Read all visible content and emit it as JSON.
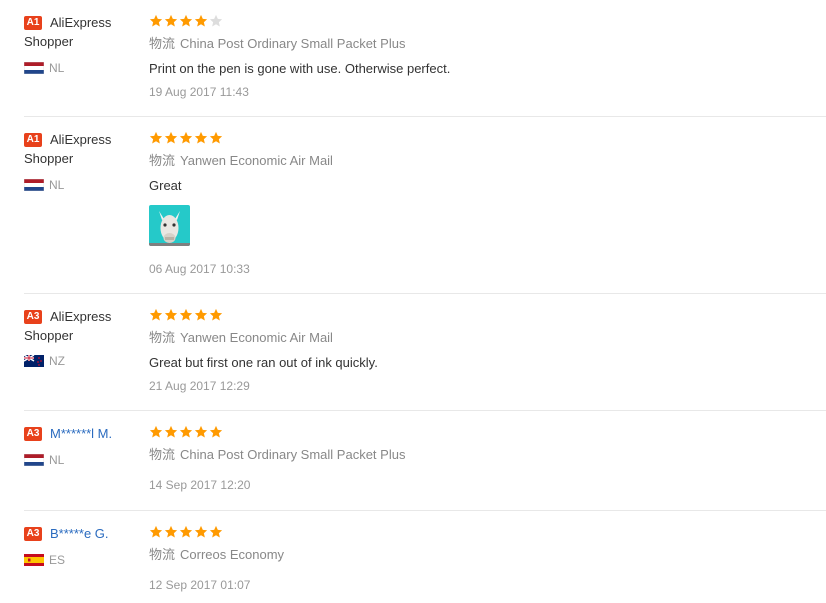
{
  "colors": {
    "badge_red": "#e8411b",
    "star_orange": "#ff9a00",
    "star_gray": "#dddddd",
    "link_blue": "#2a6bbf"
  },
  "reviews": [
    {
      "badge": "A1",
      "name_line1": "AliExpress",
      "name_line2": "Shopper",
      "country": "NL",
      "flag": "netherlands-flag-icon",
      "rating": 4,
      "logistics_label": "物流",
      "logistics": "China Post Ordinary Small Packet Plus",
      "comment": "Print on the pen is gone with use. Otherwise perfect.",
      "date": "19 Aug 2017 11:43"
    },
    {
      "badge": "A1",
      "name_line1": "AliExpress",
      "name_line2": "Shopper",
      "country": "NL",
      "flag": "netherlands-flag-icon",
      "rating": 5,
      "logistics_label": "物流",
      "logistics": "Yanwen Economic Air Mail",
      "comment": "Great",
      "date": "06 Aug 2017 10:33",
      "has_photo": true
    },
    {
      "badge": "A3",
      "name_line1": "AliExpress",
      "name_line2": "Shopper",
      "country": "NZ",
      "flag": "new-zealand-flag-icon",
      "rating": 5,
      "logistics_label": "物流",
      "logistics": "Yanwen Economic Air Mail",
      "comment": "Great but first one ran out of ink quickly.",
      "date": "21 Aug 2017 12:29"
    },
    {
      "badge": "A3",
      "name_line1": "M******l M.",
      "country": "NL",
      "flag": "netherlands-flag-icon",
      "rating": 5,
      "logistics_label": "物流",
      "logistics": "China Post Ordinary Small Packet Plus",
      "date": "14 Sep 2017 12:20"
    },
    {
      "badge": "A3",
      "name_line1": "B*****e G.",
      "country": "ES",
      "flag": "spain-flag-icon",
      "rating": 5,
      "logistics_label": "物流",
      "logistics": "Correos Economy",
      "date": "12 Sep 2017 01:07"
    }
  ]
}
